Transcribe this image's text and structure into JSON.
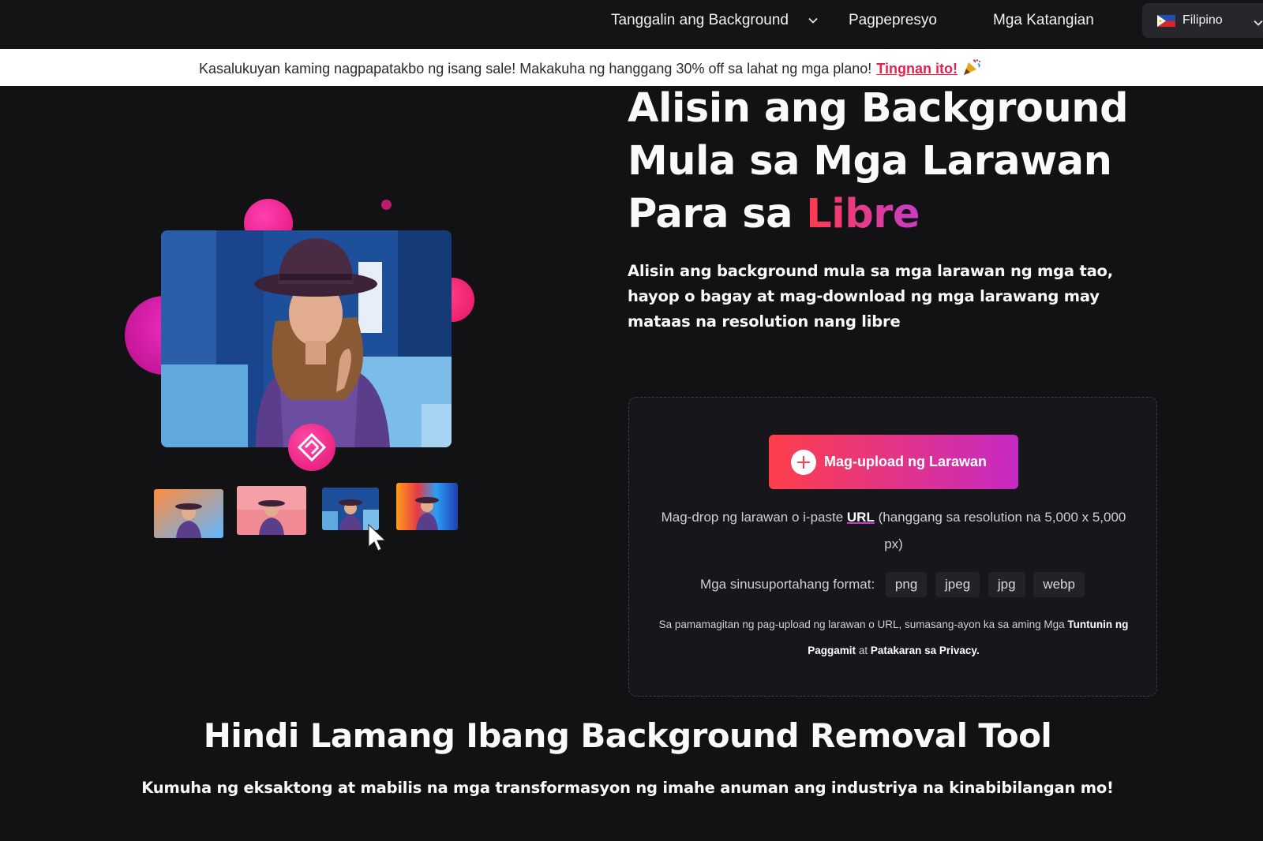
{
  "nav": {
    "remove_bg": "Tanggalin ang Background",
    "pricing": "Pagpepresyo",
    "features": "Mga Katangian",
    "language": "Filipino"
  },
  "banner": {
    "text": "Kasalukuyan kaming nagpapatakbo ng isang sale! Makakuha ng hanggang 30% off sa lahat ng mga plano!",
    "link": "Tingnan ito!"
  },
  "hero": {
    "title_line1": "Alisin ang Background",
    "title_line2": "Mula sa Mga Larawan",
    "title_line3_prefix": "Para sa",
    "title_accent": "Libre",
    "subtitle": "Alisin ang background mula sa mga larawan ng mga tao, hayop o bagay at mag-download ng mga larawang may mataas na resolution nang libre"
  },
  "upload": {
    "button": "Mag-upload ng Larawan",
    "drop_prefix": "Mag-drop ng larawan o i-paste",
    "drop_url": "URL",
    "drop_suffix": "(hanggang sa resolution na 5,000 x 5,000 px)",
    "formats_label": "Mga sinusuportahang format:",
    "formats": [
      "png",
      "jpeg",
      "jpg",
      "webp"
    ],
    "terms_prefix": "Sa pamamagitan ng pag-upload ng larawan o URL, sumasang-ayon ka sa aming Mga",
    "terms_link": "Tuntunin ng Paggamit",
    "terms_and": "at",
    "privacy_link": "Patakaran sa Privacy."
  },
  "section": {
    "title": "Hindi Lamang Ibang Background Removal Tool",
    "subtitle": "Kumuha ng eksaktong at mabilis na mga transformasyon ng imahe anuman ang industriya na kinabibilangan mo!"
  },
  "colors": {
    "accent_red": "#ff3f4a",
    "accent_magenta": "#c629c4",
    "link_red": "#e8204e",
    "background": "#121114"
  }
}
